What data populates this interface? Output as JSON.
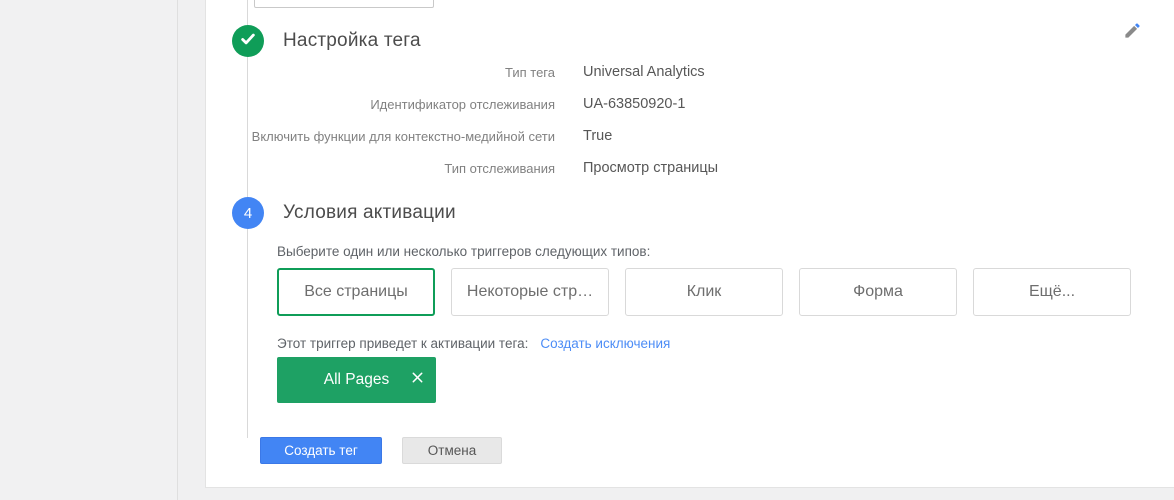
{
  "tag_setup": {
    "title": "Настройка тега",
    "fields": [
      {
        "label": "Тип тега",
        "value": "Universal Analytics"
      },
      {
        "label": "Идентификатор отслеживания",
        "value": "UA-63850920-1"
      },
      {
        "label": "Включить функции для контекстно-медийной сети",
        "value": "True"
      },
      {
        "label": "Тип отслеживания",
        "value": "Просмотр страницы"
      }
    ]
  },
  "triggering": {
    "step_number": "4",
    "title": "Условия активации",
    "instruction": "Выберите один или несколько триггеров следующих типов:",
    "trigger_type_buttons": [
      {
        "label": "Все страницы",
        "selected": true
      },
      {
        "label": "Некоторые стр…",
        "selected": false
      },
      {
        "label": "Клик",
        "selected": false
      },
      {
        "label": "Форма",
        "selected": false
      },
      {
        "label": "Ещё...",
        "selected": false
      }
    ],
    "fire_note": "Этот триггер приведет к активации тега:",
    "exceptions_link": "Создать исключения",
    "trigger_chip": {
      "label": "All Pages"
    }
  },
  "footer": {
    "create_label": "Создать тег",
    "cancel_label": "Отмена"
  },
  "colors": {
    "step_done_green": "#0f9d58",
    "chip_green": "#1ea164",
    "step_blue": "#4285f4",
    "link_blue": "#4d8df6",
    "selected_border_green": "#0f9d58"
  }
}
